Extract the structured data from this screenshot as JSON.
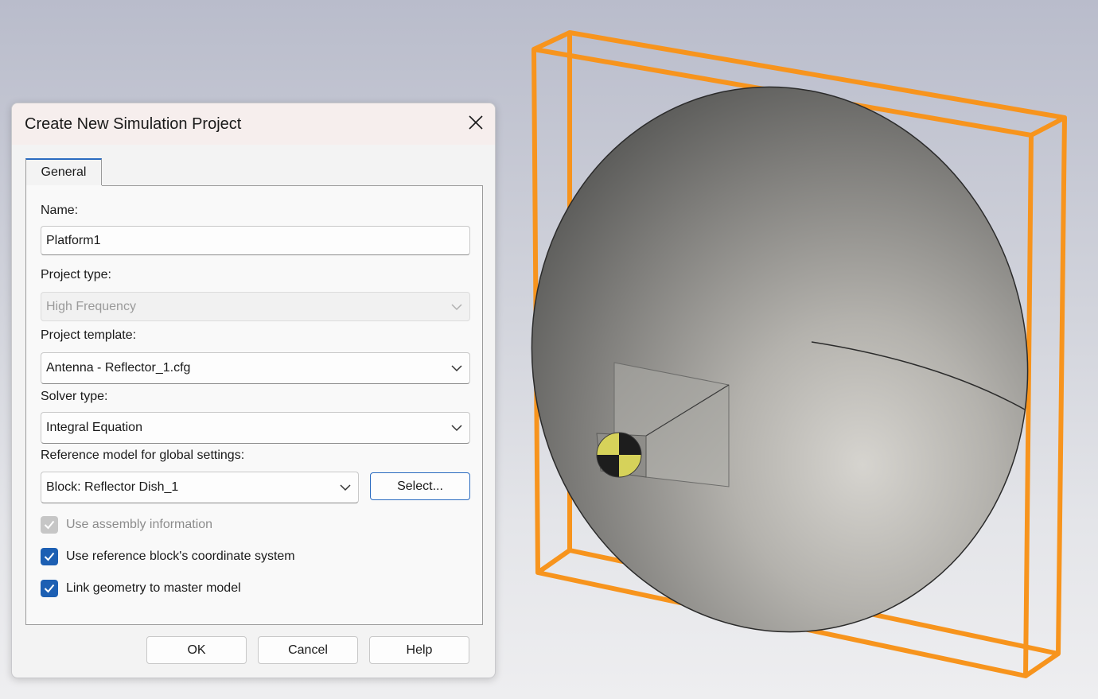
{
  "dialog": {
    "title": "Create New Simulation Project",
    "tabs": [
      {
        "label": "General"
      }
    ],
    "name": {
      "label": "Name:",
      "value": "Platform1"
    },
    "project_type": {
      "label": "Project type:",
      "value": "High Frequency"
    },
    "project_template": {
      "label": "Project template:",
      "value": "Antenna - Reflector_1.cfg"
    },
    "solver_type": {
      "label": "Solver type:",
      "value": "Integral Equation"
    },
    "reference_model": {
      "label": "Reference model for global settings:",
      "value": "Block: Reflector Dish_1",
      "select_label": "Select..."
    },
    "checkboxes": [
      {
        "label": "Use assembly information",
        "checked": true,
        "enabled": false
      },
      {
        "label": "Use reference block's coordinate system",
        "checked": true,
        "enabled": true
      },
      {
        "label": "Link geometry to master model",
        "checked": true,
        "enabled": true
      }
    ],
    "buttons": {
      "ok": "OK",
      "cancel": "Cancel",
      "help": "Help"
    }
  },
  "icons": {
    "close": "close-icon",
    "dropdown": "chevron-down-icon",
    "check": "checkmark-icon"
  },
  "colors": {
    "bounding_box": "#f7941d",
    "accent": "#1c5fb3",
    "checkbox_disabled": "#c6c6c6"
  }
}
